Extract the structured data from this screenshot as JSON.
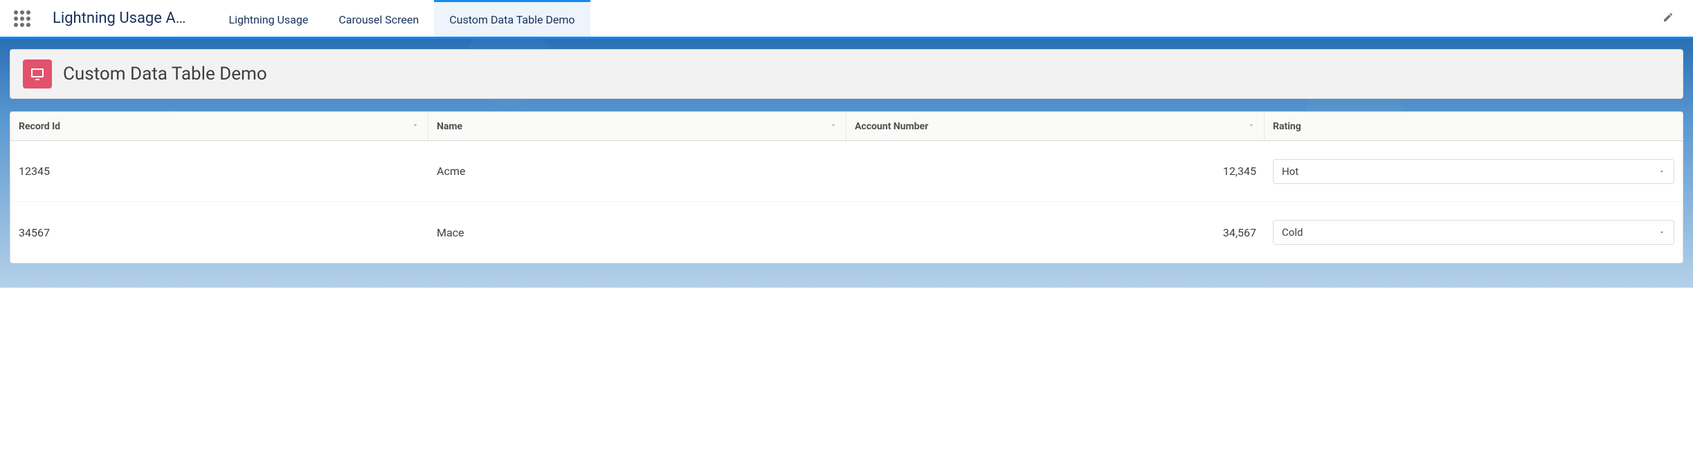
{
  "header": {
    "app_name": "Lightning Usage A…",
    "tabs": [
      {
        "label": "Lightning Usage",
        "active": false
      },
      {
        "label": "Carousel Screen",
        "active": false
      },
      {
        "label": "Custom Data Table Demo",
        "active": true
      }
    ]
  },
  "page": {
    "title": "Custom Data Table Demo",
    "icon": "display-icon"
  },
  "table": {
    "columns": [
      {
        "key": "id",
        "label": "Record Id",
        "sortable": true
      },
      {
        "key": "name",
        "label": "Name",
        "sortable": true
      },
      {
        "key": "acct",
        "label": "Account Number",
        "sortable": true
      },
      {
        "key": "rating",
        "label": "Rating",
        "sortable": false
      }
    ],
    "rows": [
      {
        "id": "12345",
        "name": "Acme",
        "acct": "12,345",
        "rating": "Hot"
      },
      {
        "id": "34567",
        "name": "Mace",
        "acct": "34,567",
        "rating": "Cold"
      }
    ]
  }
}
